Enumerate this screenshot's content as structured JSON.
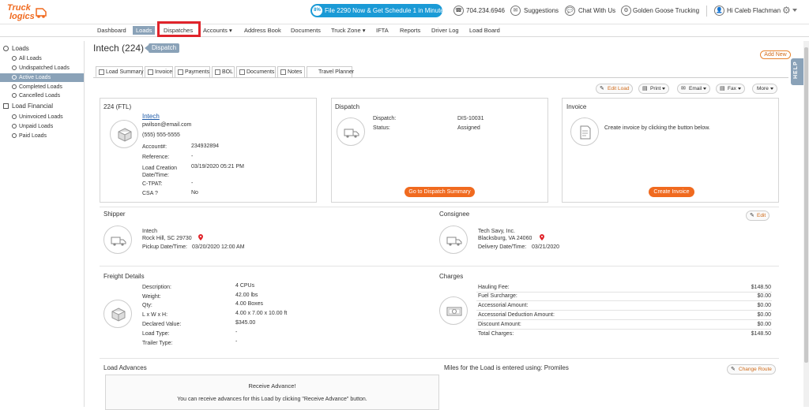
{
  "brand": {
    "logo_line1": "Truck",
    "logo_line2": "logics"
  },
  "topbar": {
    "promo": "File 2290 Now & Get Schedule 1 in Minutes",
    "promo_badge": "8%",
    "phone": "704.234.6946",
    "suggestions": "Suggestions",
    "chat": "Chat With Us",
    "company": "Golden Goose Trucking",
    "user": "Hi Caleb Flachman"
  },
  "nav": {
    "items": [
      "Dashboard",
      "Loads",
      "Dispatches",
      "Accounts",
      "Address Book",
      "Documents",
      "Truck Zone",
      "IFTA",
      "Reports",
      "Driver Log",
      "Load Board"
    ],
    "add_new": "Add New"
  },
  "sidebar": {
    "loads_header": "Loads",
    "loads_items": [
      "All Loads",
      "Undispatched Loads",
      "Active Loads",
      "Completed Loads",
      "Cancelled Loads"
    ],
    "financial_header": "Load Financial",
    "financial_items": [
      "Uninvoiced Loads",
      "Unpaid Loads",
      "Paid Loads"
    ]
  },
  "page": {
    "title": "Intech (224)",
    "status_tag": "Dispatch"
  },
  "tabs": [
    "Load Summary",
    "Invoice",
    "Payments",
    "BOL",
    "Documents",
    "Notes",
    "Travel Planner"
  ],
  "actions": {
    "edit_load": "Edit Load",
    "print": "Print",
    "email": "Email",
    "fax": "Fax",
    "more": "More"
  },
  "load": {
    "header": "224 (FTL)",
    "customer": "Intech",
    "email": "pwilson@email.com",
    "phone": "(555) 555-5555",
    "fields": [
      {
        "label": "Account#:",
        "value": "234932894"
      },
      {
        "label": "Reference:",
        "value": "-"
      },
      {
        "label": "Load Creation Date/Time:",
        "value": "03/19/2020 05:21 PM"
      },
      {
        "label": "C-TPAT:",
        "value": "-"
      },
      {
        "label": "CSA ?",
        "value": "No"
      }
    ]
  },
  "dispatch": {
    "header": "Dispatch",
    "dispatch_label": "Dispatch:",
    "dispatch_value": "DIS-10031",
    "status_label": "Status:",
    "status_value": "Assigned",
    "button": "Go to Dispatch Summary"
  },
  "invoice": {
    "header": "Invoice",
    "text": "Create invoice by clicking the button below.",
    "button": "Create Invoice"
  },
  "shipper": {
    "header": "Shipper",
    "name": "Intech",
    "city": "Rock Hill, SC 29730",
    "date_label": "Pickup Date/Time:",
    "date_value": "03/20/2020  12:00 AM"
  },
  "consignee": {
    "header": "Consignee",
    "name": "Tech Savy, Inc.",
    "city": "Blacksburg, VA 24060",
    "date_label": "Delivery Date/Time:",
    "date_value": "03/21/2020",
    "edit": "Edit"
  },
  "freight": {
    "header": "Freight Details",
    "rows": [
      {
        "label": "Description:",
        "value": "4 CPUs"
      },
      {
        "label": "Weight:",
        "value": "42.00 lbs"
      },
      {
        "label": "Qty:",
        "value": "4.00 Boxes"
      },
      {
        "label": "L x W x H:",
        "value": "4.00 x 7.00 x 10.00 ft"
      },
      {
        "label": "Declared Value:",
        "value": "$345.00"
      },
      {
        "label": "Load Type:",
        "value": "-"
      },
      {
        "label": "Trailer Type:",
        "value": "-"
      }
    ]
  },
  "charges": {
    "header": "Charges",
    "rows": [
      {
        "label": "Hauling Fee:",
        "value": "$148.50"
      },
      {
        "label": "Fuel Surcharge:",
        "value": "$0.00"
      },
      {
        "label": "Accessorial Amount:",
        "value": "$0.00"
      },
      {
        "label": "Accessorial Deduction Amount:",
        "value": "$0.00"
      },
      {
        "label": "Discount Amount:",
        "value": "$0.00"
      },
      {
        "label": "Total Charges:",
        "value": "$148.50"
      }
    ]
  },
  "advances": {
    "header": "Load Advances",
    "box_title": "Receive Advance!",
    "box_text": "You can receive advances for this Load by clicking \"Receive Advance\" button."
  },
  "miles": {
    "text": "Miles for the Load is entered using: Promiles",
    "button": "Change Route"
  },
  "help": "HELP",
  "colors": {
    "accent": "#f06a1f",
    "nav_active": "#8aa2b8",
    "promo": "#1a9ad6",
    "highlight": "#e0242b"
  }
}
